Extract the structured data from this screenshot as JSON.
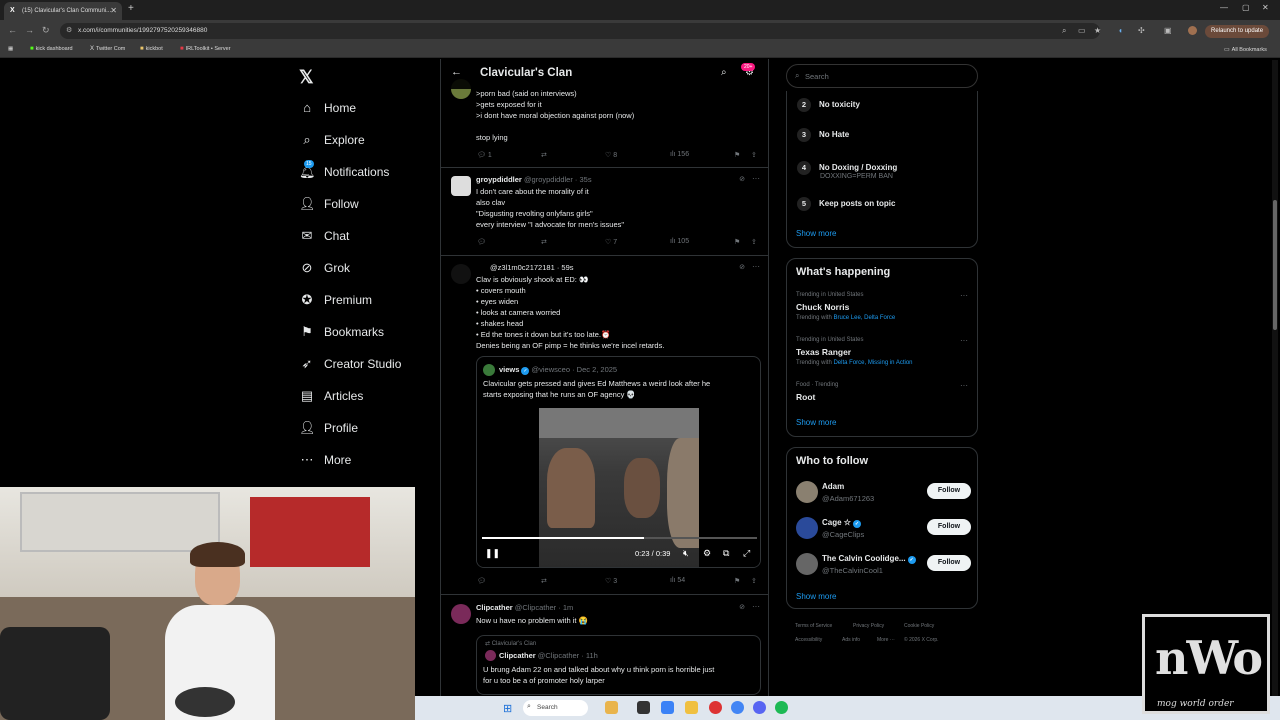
{
  "browser": {
    "tab_title": "(15) Clavicular's Clan Communi...",
    "url": "x.com/i/communities/1992797520259346880",
    "relaunch": "Relaunch to update",
    "bookmarks": [
      "kick dashboard",
      "Twitter Com",
      "kickbot",
      "IRLToolkit • Server"
    ],
    "all_bookmarks": "All Bookmarks"
  },
  "nav": {
    "items": [
      "Home",
      "Explore",
      "Notifications",
      "Follow",
      "Chat",
      "Grok",
      "Premium",
      "Bookmarks",
      "Creator Studio",
      "Articles",
      "Profile",
      "More"
    ],
    "notif_badge": "15"
  },
  "header": {
    "title": "Clavicular's Clan",
    "badge": "20+"
  },
  "tweets": [
    {
      "lines": [
        ">porn bad (said on interviews)",
        ">gets exposed for it",
        ">i dont have moral objection against porn (now)",
        "",
        "stop lying"
      ],
      "replies": "1",
      "likes": "8",
      "views": "156"
    },
    {
      "name": "groypdiddler",
      "handle": "@groypdiddler · 35s",
      "lines": [
        "I don't care about the morality of it",
        "also clav",
        "\"Disgusting revolting onlyfans girls\"",
        "every interview \"I advocate for men's issues\""
      ],
      "likes": "7",
      "views": "105"
    },
    {
      "handle": "@z3l1m0c2172181 · 59s",
      "lines": [
        "Clav is obviously shook at ED: 👀",
        "• covers mouth",
        "• eyes widen",
        "• looks at camera worried",
        "• shakes head",
        "• Ed the tones it down but it's too late.⏰",
        "Denies being an OF pimp = he thinks we're incel retards."
      ],
      "quote_name": "views",
      "quote_handle": "@viewsceo · Dec 2, 2025",
      "quote_lines": [
        "Clavicular gets pressed and gives Ed Matthews a weird look after he",
        "starts exposing that he runs an OF agency 💀"
      ],
      "video_time": "0:23 / 0:39",
      "video_progress": 0.59,
      "likes": "3",
      "views": "54"
    },
    {
      "name": "Clipcather",
      "handle": "@Clipcather · 1m",
      "lines": [
        "Now u have no problem with it 😭"
      ],
      "quote_community": "Clavicular's Clan",
      "quote_name": "Clipcather",
      "quote_handle": "@Clipcather · 11h",
      "quote_lines": [
        "U brung Adam 22 on and talked about why u think porn is horrible just",
        "for u too be a of promoter holy larper"
      ]
    }
  ],
  "right": {
    "search_placeholder": "Search",
    "rules": [
      {
        "n": "2",
        "t": "No toxicity"
      },
      {
        "n": "3",
        "t": "No Hate"
      },
      {
        "n": "4",
        "t": "No Doxing / Doxxing",
        "s": "DOXXING=PERM BAN"
      },
      {
        "n": "5",
        "t": "Keep posts on topic"
      }
    ],
    "show_more": "Show more",
    "happening_title": "What's happening",
    "trends": [
      {
        "ctx": "Trending in United States",
        "name": "Chuck Norris",
        "with_label": "Trending with ",
        "with": "Bruce Lee, Delta Force"
      },
      {
        "ctx": "Trending in United States",
        "name": "Texas Ranger",
        "with_label": "Trending with ",
        "with": "Delta Force, Missing in Action"
      },
      {
        "ctx": "Food · Trending",
        "name": "Root"
      }
    ],
    "wtf_title": "Who to follow",
    "follow": [
      {
        "name": "Adam",
        "handle": "@Adam671263",
        "btn": "Follow"
      },
      {
        "name": "Cage ☆",
        "handle": "@CageClips",
        "btn": "Follow"
      },
      {
        "name": "The Calvin Coolidge...",
        "handle": "@TheCalvinCool1",
        "btn": "Follow"
      }
    ],
    "footer": [
      "Terms of Service",
      "Privacy Policy",
      "Cookie Policy",
      "Accessibility",
      "Ads info",
      "More ···",
      "© 2026 X Corp."
    ]
  },
  "taskbar": {
    "search": "Search"
  },
  "overlay": {
    "logo_big": "nWo",
    "logo_small": "mog world order"
  }
}
